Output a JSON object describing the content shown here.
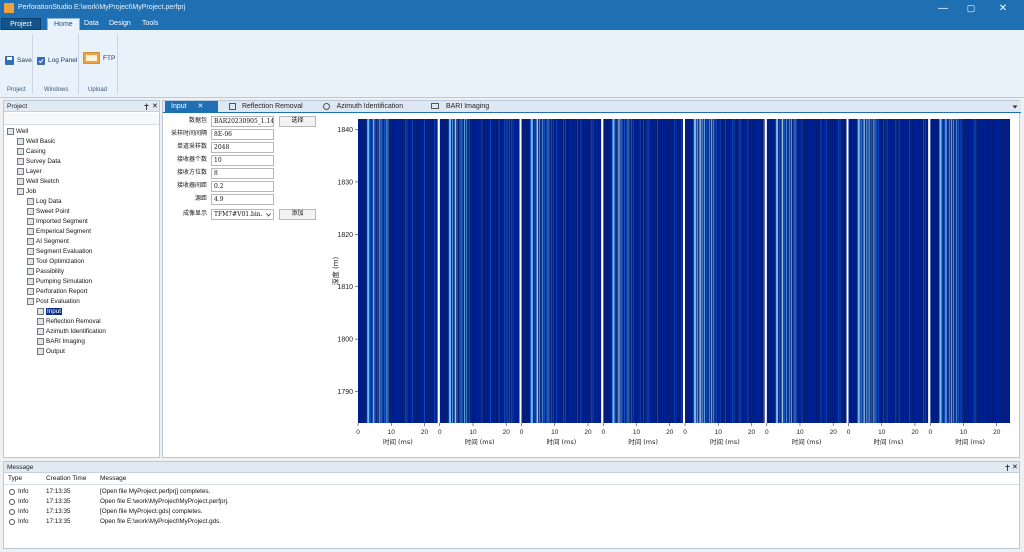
{
  "window": {
    "title": "PerforationStudio E:\\work\\MyProject\\MyProject.perfprj",
    "min_symbol": "—",
    "max_symbol": "▢",
    "close_symbol": "✕"
  },
  "menu": {
    "items": [
      "Project",
      "Home",
      "Data",
      "Design",
      "Tools"
    ]
  },
  "ribbon": {
    "save_label": "Save",
    "log_panel_label": "Log Panel",
    "ftp_label": "FTP",
    "groups": [
      "Project",
      "Windows",
      "Upload"
    ]
  },
  "project_panel": {
    "title": "Project",
    "pin_icon": "pin-icon",
    "close_symbol": "✕",
    "tree": [
      {
        "label": "Well",
        "level": 0,
        "icon": "well-icon"
      },
      {
        "label": "Well Basic",
        "level": 1,
        "icon": "basic-icon"
      },
      {
        "label": "Casing",
        "level": 1,
        "icon": "casing-icon"
      },
      {
        "label": "Survey Data",
        "level": 1,
        "icon": "survey-icon"
      },
      {
        "label": "Layer",
        "level": 1,
        "icon": "layer-icon"
      },
      {
        "label": "Well Sketch",
        "level": 1,
        "icon": "sketch-icon"
      },
      {
        "label": "Job",
        "level": 1,
        "icon": "job-icon"
      },
      {
        "label": "Log Data",
        "level": 2,
        "icon": "log-icon"
      },
      {
        "label": "Sweet Point",
        "level": 2,
        "icon": "point-icon"
      },
      {
        "label": "Imported Segment",
        "level": 2,
        "icon": "segment-icon"
      },
      {
        "label": "Emperical Segment",
        "level": 2,
        "icon": "segment-icon"
      },
      {
        "label": "AI Segment",
        "level": 2,
        "icon": "ai-icon"
      },
      {
        "label": "Segment Evaluation",
        "level": 2,
        "icon": "eval-icon"
      },
      {
        "label": "Tool Optimization",
        "level": 2,
        "icon": "tool-icon"
      },
      {
        "label": "Passibility",
        "level": 2,
        "icon": "pass-icon"
      },
      {
        "label": "Pumping Simulation",
        "level": 2,
        "icon": "pump-icon"
      },
      {
        "label": "Perforation Report",
        "level": 2,
        "icon": "report-icon"
      },
      {
        "label": "Post Evaluation",
        "level": 2,
        "icon": "post-icon"
      },
      {
        "label": "Input",
        "level": 3,
        "icon": "input-icon",
        "selected": true
      },
      {
        "label": "Reflection Removal",
        "level": 3,
        "icon": "reflection-icon"
      },
      {
        "label": "Azimuth Identification",
        "level": 3,
        "icon": "azimuth-icon"
      },
      {
        "label": "BARI Imaging",
        "level": 3,
        "icon": "bari-icon"
      },
      {
        "label": "Output",
        "level": 3,
        "icon": "output-icon"
      }
    ]
  },
  "tabs": [
    {
      "label": "Input",
      "active": true,
      "close": "✕"
    },
    {
      "label": "Reflection Removal"
    },
    {
      "label": "Azimuth Identification"
    },
    {
      "label": "BARI Imaging"
    }
  ],
  "form": {
    "fields": [
      {
        "label": "数据包",
        "value": "BAR20230905_1.14f"
      },
      {
        "label": "采样时间间隔",
        "value": "8E-06"
      },
      {
        "label": "单道采样数",
        "value": "2048"
      },
      {
        "label": "接收器个数",
        "value": "10"
      },
      {
        "label": "接收方位数",
        "value": "8"
      },
      {
        "label": "接收器间距",
        "value": "0.2"
      },
      {
        "label": "源距",
        "value": "4.9"
      },
      {
        "label": "成像显示",
        "value": "TFM7#V01.bin."
      }
    ],
    "select_button": "选择",
    "add_button": "添加"
  },
  "chart_data": {
    "type": "heatmap",
    "panel_count": 8,
    "ylabel": "深度 (m)",
    "xlabel": "时间 (ms)",
    "y_ticks": [
      1840,
      1830,
      1820,
      1810,
      1800,
      1790
    ],
    "ylim": [
      1784,
      1842
    ],
    "x_ticks": [
      0,
      10,
      20
    ],
    "xlim": [
      0,
      24
    ],
    "colormap": [
      "#00186e",
      "#0030c8",
      "#1c6ef0",
      "#7fd0ff",
      "#ffffff"
    ]
  },
  "message_panel": {
    "title": "Message",
    "pin_icon": "pin-icon",
    "close_symbol": "✕",
    "columns": [
      "Type",
      "Creation Time",
      "Message"
    ],
    "rows": [
      {
        "type": "Info",
        "time": "17:13:35",
        "message": "[Open file MyProject.perfprj] completes."
      },
      {
        "type": "Info",
        "time": "17:13:35",
        "message": "Open file E:\\work\\MyProject\\MyProject.perfprj."
      },
      {
        "type": "Info",
        "time": "17:13:35",
        "message": "[Open file MyProject.gds] completes."
      },
      {
        "type": "Info",
        "time": "17:13:35",
        "message": "Open file E:\\work\\MyProject\\MyProject.gds."
      }
    ]
  }
}
